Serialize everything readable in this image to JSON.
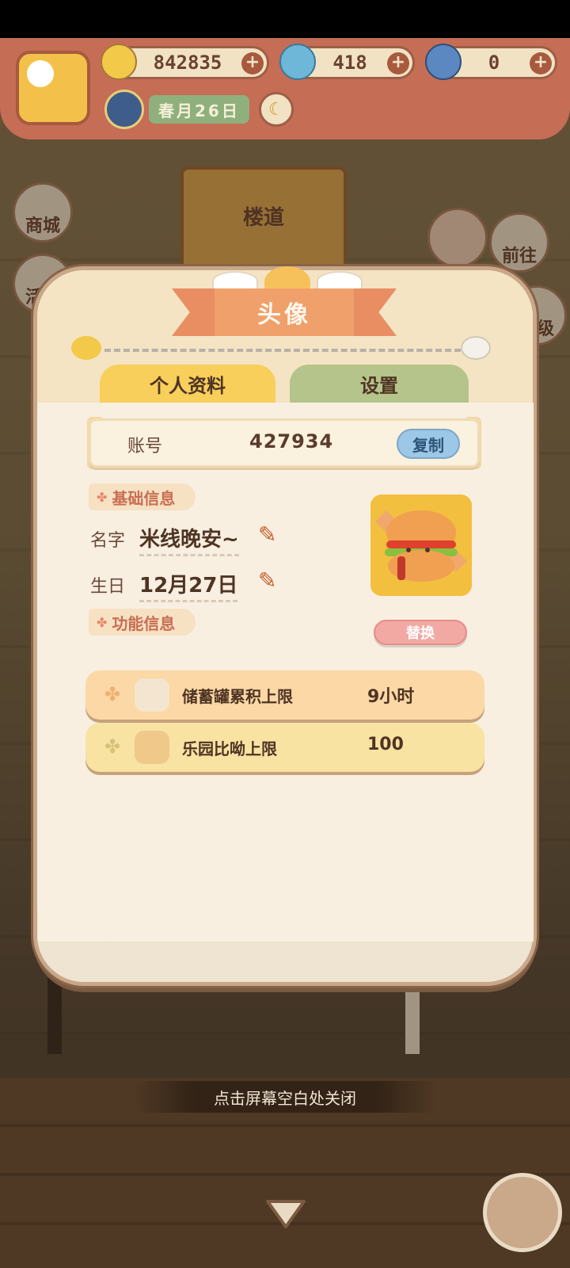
{
  "hud": {
    "coins": "842835",
    "gems": "418",
    "tickets": "0",
    "date_text": "春月26日"
  },
  "background": {
    "sign_label": "楼道",
    "side_buttons": [
      "商城",
      "活动",
      "前往",
      "等级"
    ]
  },
  "modal": {
    "title": "头像",
    "tabs": {
      "profile": "个人资料",
      "settings": "设置"
    },
    "account": {
      "label": "账号",
      "value": "427934",
      "copy_label": "复制"
    },
    "basic_section": "基础信息",
    "name": {
      "label": "名字",
      "value": "米线晚安~"
    },
    "birthday": {
      "label": "生日",
      "value": "12月27日"
    },
    "function_section": "功能信息",
    "replace_label": "替换",
    "rows": [
      {
        "label": "储蓄罐累积上限",
        "value": "9小时"
      },
      {
        "label": "乐园比呦上限",
        "value": "100"
      }
    ]
  },
  "close_hint": "点击屏幕空白处关闭",
  "icons": [
    "banana-coin-icon",
    "blue-flame-icon",
    "blue-banana-icon",
    "moon-season-icon",
    "crescent-moon-icon",
    "pencil-icon",
    "clover-icon",
    "burger-avatar-icon",
    "piggy-bank-icon",
    "hamster-icon",
    "yarn-ball-icon",
    "down-arrow-icon"
  ],
  "colors": {
    "banner": "#c56d55",
    "ribbon": "#e98e62",
    "tab_active": "#f7cf5a",
    "tab_inactive": "#b5c48a",
    "copy_button": "#9dc7e6",
    "replace_button": "#f2a9a4"
  }
}
